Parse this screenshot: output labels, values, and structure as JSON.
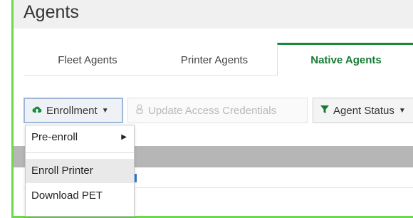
{
  "page": {
    "title": "Agents"
  },
  "tabs": [
    {
      "label": "Fleet Agents"
    },
    {
      "label": "Printer Agents"
    },
    {
      "label": "Native Agents",
      "active": true
    }
  ],
  "toolbar": {
    "enrollment_label": "Enrollment",
    "enrollment_icon": "cloud-upload-icon",
    "update_label": "Update Access Credentials",
    "update_icon": "key-person-icon",
    "agent_status_label": "Agent Status",
    "agent_status_icon": "filter-icon"
  },
  "enrollment_menu": {
    "items": [
      {
        "label": "Pre-enroll",
        "has_submenu": true
      },
      {
        "label": "Enroll Printer",
        "hovered": true
      },
      {
        "label": "Download PET"
      }
    ]
  },
  "colors": {
    "accent_green": "#1b8a3a",
    "highlight_border": "#6cd94b",
    "grid_header": "#b6b6b6"
  }
}
